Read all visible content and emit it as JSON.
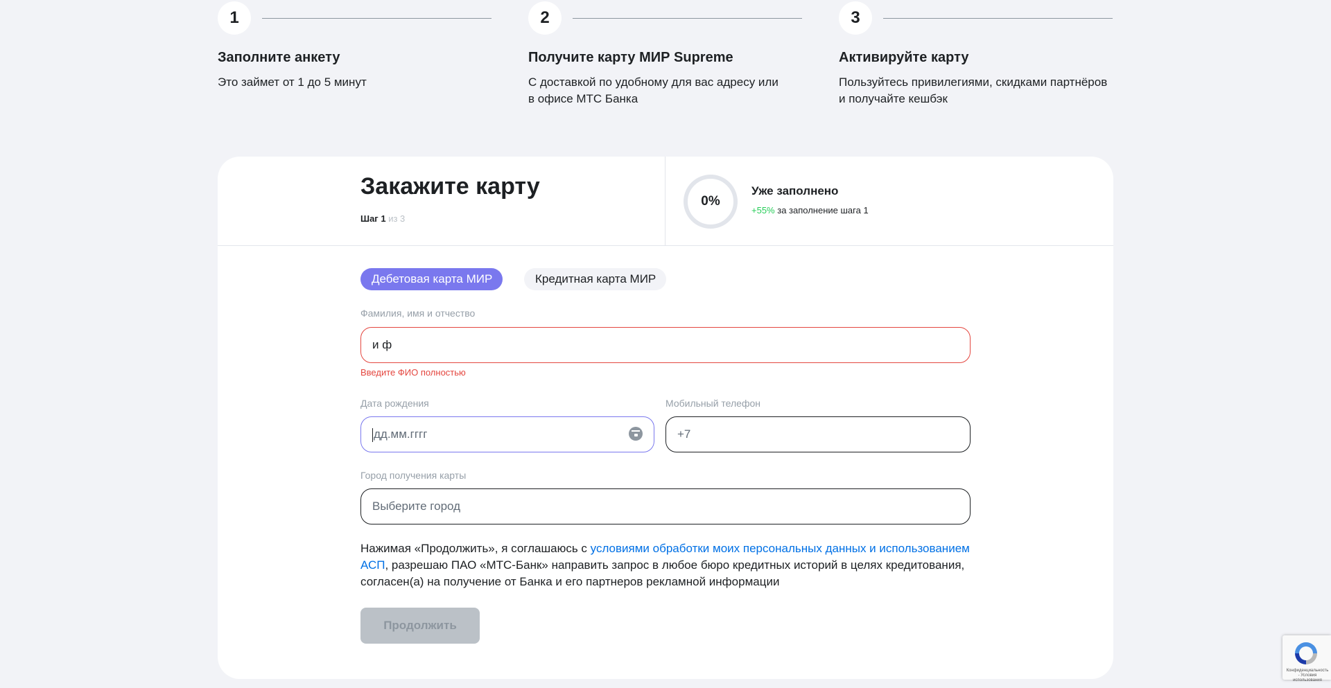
{
  "steps": [
    {
      "number": "1",
      "title": "Заполните анкету",
      "description": "Это займет от 1 до 5 минут"
    },
    {
      "number": "2",
      "title": "Получите карту МИР Supreme",
      "description": "С доставкой по удобному для вас адресу или в офисе МТС Банка"
    },
    {
      "number": "3",
      "title": "Активируйте карту",
      "description": "Пользуйтесь привилегиями, скидками партнёров и получайте кешбэк"
    }
  ],
  "form": {
    "title": "Закажите карту",
    "step_label": "Шаг 1",
    "step_total": "из 3",
    "progress": {
      "value": "0%",
      "fraction": 0,
      "title": "Уже заполнено",
      "bonus": "+55%",
      "bonus_text": "за заполнение шага 1"
    },
    "tabs": [
      {
        "label": "Дебетовая карта МИР",
        "selected": true
      },
      {
        "label": "Кредитная карта МИР",
        "selected": false
      }
    ],
    "fio": {
      "label": "Фамилия, имя и отчество",
      "value": "и ф",
      "error": "Введите ФИО полностью"
    },
    "birthdate": {
      "label": "Дата рождения",
      "placeholder": "дд.мм.гггг",
      "icon": "calendar-icon"
    },
    "phone": {
      "label": "Мобильный телефон",
      "value": "+7"
    },
    "city": {
      "label": "Город получения карты",
      "placeholder": "Выберите город"
    },
    "consent": {
      "before": "Нажимая «Продолжить», я соглашаюсь с ",
      "link": "условиями обработки моих персональных данных и использованием АСП",
      "after": ", разрешаю ПАО «МТС-Банк» направить запрос в любое бюро кредитных историй в целях кредитования, согласен(а) на получение от Банка и его партнеров рекламной информации"
    },
    "submit_label": "Продолжить"
  },
  "recaptcha": {
    "text": "Конфиденциальность - Условия использования"
  },
  "colors": {
    "accent": "#7a78ee",
    "error": "#e4463f",
    "link": "#0070e5",
    "success": "#26cd58",
    "disabled": "#bbc1c7"
  }
}
